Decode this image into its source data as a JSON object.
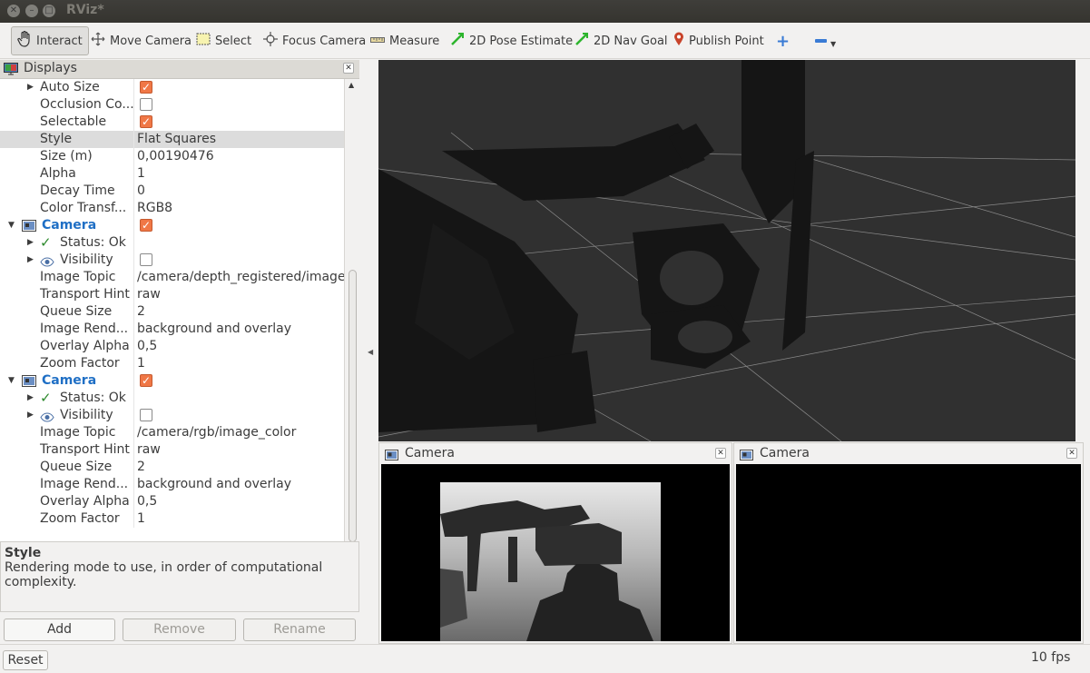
{
  "window": {
    "title": "RViz*"
  },
  "toolbar": {
    "tools": [
      {
        "label": "Interact",
        "icon": "hand-icon"
      },
      {
        "label": "Move Camera",
        "icon": "move-camera-icon"
      },
      {
        "label": "Select",
        "icon": "select-icon"
      },
      {
        "label": "Focus Camera",
        "icon": "focus-camera-icon"
      },
      {
        "label": "Measure",
        "icon": "ruler-icon"
      },
      {
        "label": "2D Pose Estimate",
        "icon": "green-arrow-icon"
      },
      {
        "label": "2D Nav Goal",
        "icon": "green-arrow-icon"
      },
      {
        "label": "Publish Point",
        "icon": "map-pin-icon"
      }
    ]
  },
  "displays": {
    "header": "Displays",
    "rows": [
      {
        "name": "Auto Size",
        "check": true,
        "arrow": true
      },
      {
        "name": "Occlusion Co...",
        "check": false
      },
      {
        "name": "Selectable",
        "check": true
      },
      {
        "name": "Style",
        "value": "Flat Squares"
      },
      {
        "name": "Size (m)",
        "value": "0,00190476"
      },
      {
        "name": "Alpha",
        "value": "1"
      },
      {
        "name": "Decay Time",
        "value": "0"
      },
      {
        "name": "Color Transf...",
        "value": "RGB8"
      },
      {
        "name": "Camera",
        "check": true
      },
      {
        "name": "Status: Ok"
      },
      {
        "name": "Visibility",
        "check": false
      },
      {
        "name": "Image Topic",
        "value": "/camera/depth_registered/image"
      },
      {
        "name": "Transport Hint",
        "value": "raw"
      },
      {
        "name": "Queue Size",
        "value": "2"
      },
      {
        "name": "Image Rend...",
        "value": "background and overlay"
      },
      {
        "name": "Overlay Alpha",
        "value": "0,5"
      },
      {
        "name": "Zoom Factor",
        "value": "1"
      },
      {
        "name": "Camera",
        "check": true
      },
      {
        "name": "Status: Ok"
      },
      {
        "name": "Visibility",
        "check": false
      },
      {
        "name": "Image Topic",
        "value": "/camera/rgb/image_color"
      },
      {
        "name": "Transport Hint",
        "value": "raw"
      },
      {
        "name": "Queue Size",
        "value": "2"
      },
      {
        "name": "Image Rend...",
        "value": "background and overlay"
      },
      {
        "name": "Overlay Alpha",
        "value": "0,5"
      },
      {
        "name": "Zoom Factor",
        "value": "1"
      }
    ]
  },
  "description": {
    "title": "Style",
    "text": "Rendering mode to use, in order of computational complexity."
  },
  "buttons": {
    "add": "Add",
    "remove": "Remove",
    "rename": "Rename",
    "reset": "Reset"
  },
  "camera_panels": [
    {
      "title": "Camera"
    },
    {
      "title": "Camera"
    }
  ],
  "status": {
    "fps": "10 fps"
  },
  "colors": {
    "accent_check": "#f07746",
    "camera_link": "#1f6fc5",
    "viewport_bg": "#303030"
  }
}
